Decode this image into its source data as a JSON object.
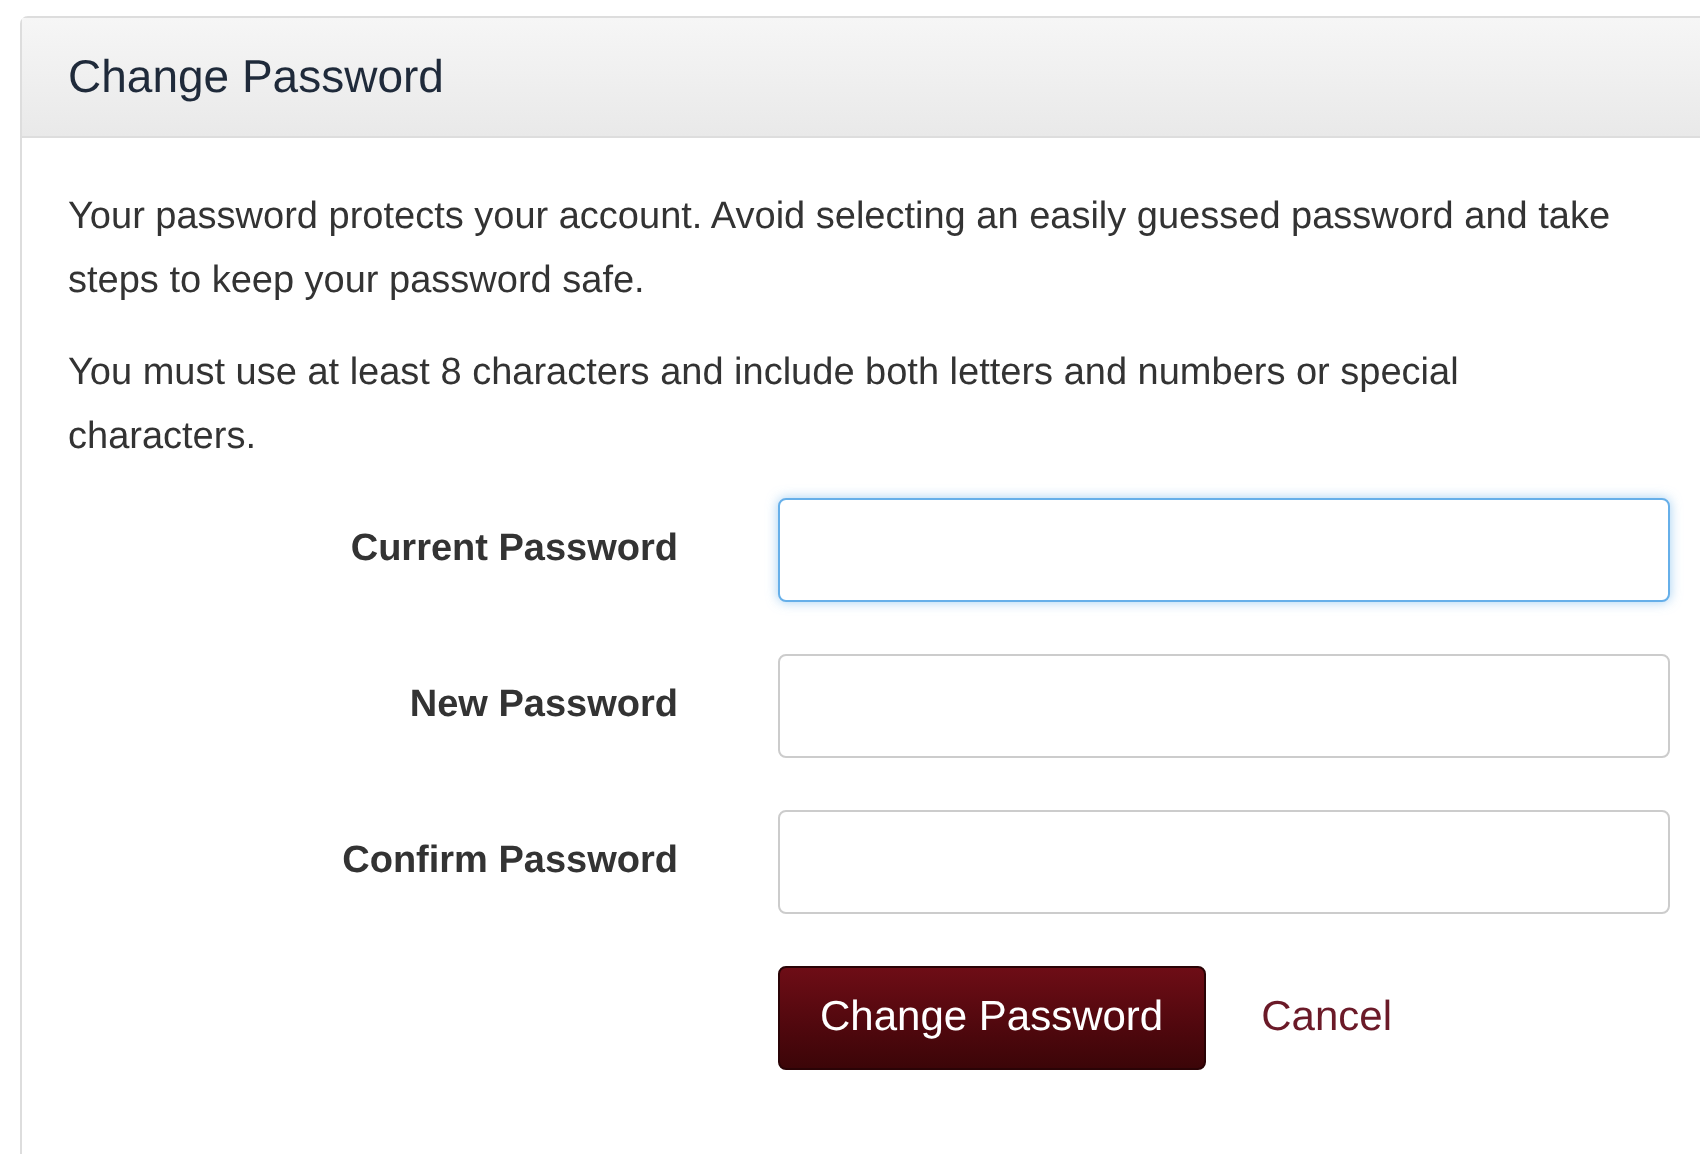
{
  "panel": {
    "title": "Change Password"
  },
  "paragraphs": [
    "Your password protects your account. Avoid selecting an easily guessed password and take steps to keep your password safe.",
    "You must use at least 8 characters and include both letters and numbers or special characters."
  ],
  "fields": [
    {
      "label": "Current Password",
      "focused": true
    },
    {
      "label": "New Password",
      "focused": false
    },
    {
      "label": "Confirm Password",
      "focused": false
    }
  ],
  "buttons": [
    {
      "kind": "primary",
      "label": "Change Password"
    },
    {
      "kind": "link",
      "label": "Cancel"
    }
  ]
}
